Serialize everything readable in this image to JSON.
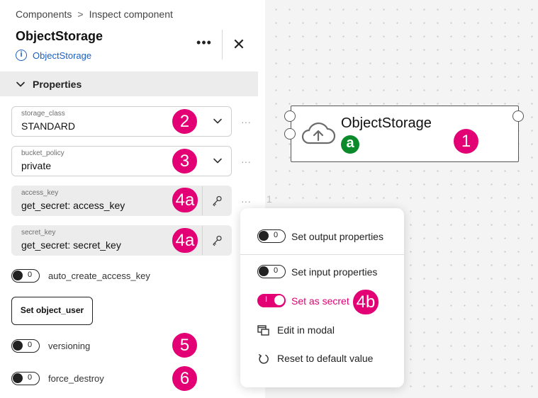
{
  "breadcrumb": {
    "parent": "Components",
    "separator": ">",
    "current": "Inspect component"
  },
  "header": {
    "title": "ObjectStorage",
    "type_link": "ObjectStorage",
    "more_label": "•••",
    "close_label": "✕"
  },
  "section": {
    "label": "Properties"
  },
  "fields": {
    "storage_class": {
      "label": "storage_class",
      "value": "STANDARD"
    },
    "bucket_policy": {
      "label": "bucket_policy",
      "value": "private"
    },
    "access_key": {
      "label": "access_key",
      "value": "get_secret: access_key"
    },
    "secret_key": {
      "label": "secret_key",
      "value": "get_secret: secret_key"
    }
  },
  "toggles": {
    "auto_create_access_key": {
      "label": "auto_create_access_key",
      "value": "0"
    },
    "versioning": {
      "label": "versioning",
      "value": "0"
    },
    "force_destroy": {
      "label": "force_destroy",
      "value": "0"
    }
  },
  "set_object_user_button": "Set object_user",
  "row_menu_dots": "···",
  "canvas_stray_char": "1",
  "node": {
    "title": "ObjectStorage",
    "icon": "cloud-upload-icon"
  },
  "badges": {
    "node": "1",
    "node_letter": "a",
    "storage_class": "2",
    "bucket_policy": "3",
    "access_key": "4a",
    "secret_key": "4a",
    "set_as_secret": "4b",
    "versioning": "5",
    "force_destroy": "6"
  },
  "menu": {
    "output": {
      "label": "Set output properties",
      "toggle": "0"
    },
    "input": {
      "label": "Set input properties",
      "toggle": "0"
    },
    "secret": {
      "label": "Set as secret",
      "toggle": "I"
    },
    "modal": {
      "label": "Edit in modal"
    },
    "reset": {
      "label": "Reset to default value"
    }
  },
  "colors": {
    "accent": "#e20074",
    "link": "#1b5fc1",
    "badge_green": "#0a8a2a"
  }
}
